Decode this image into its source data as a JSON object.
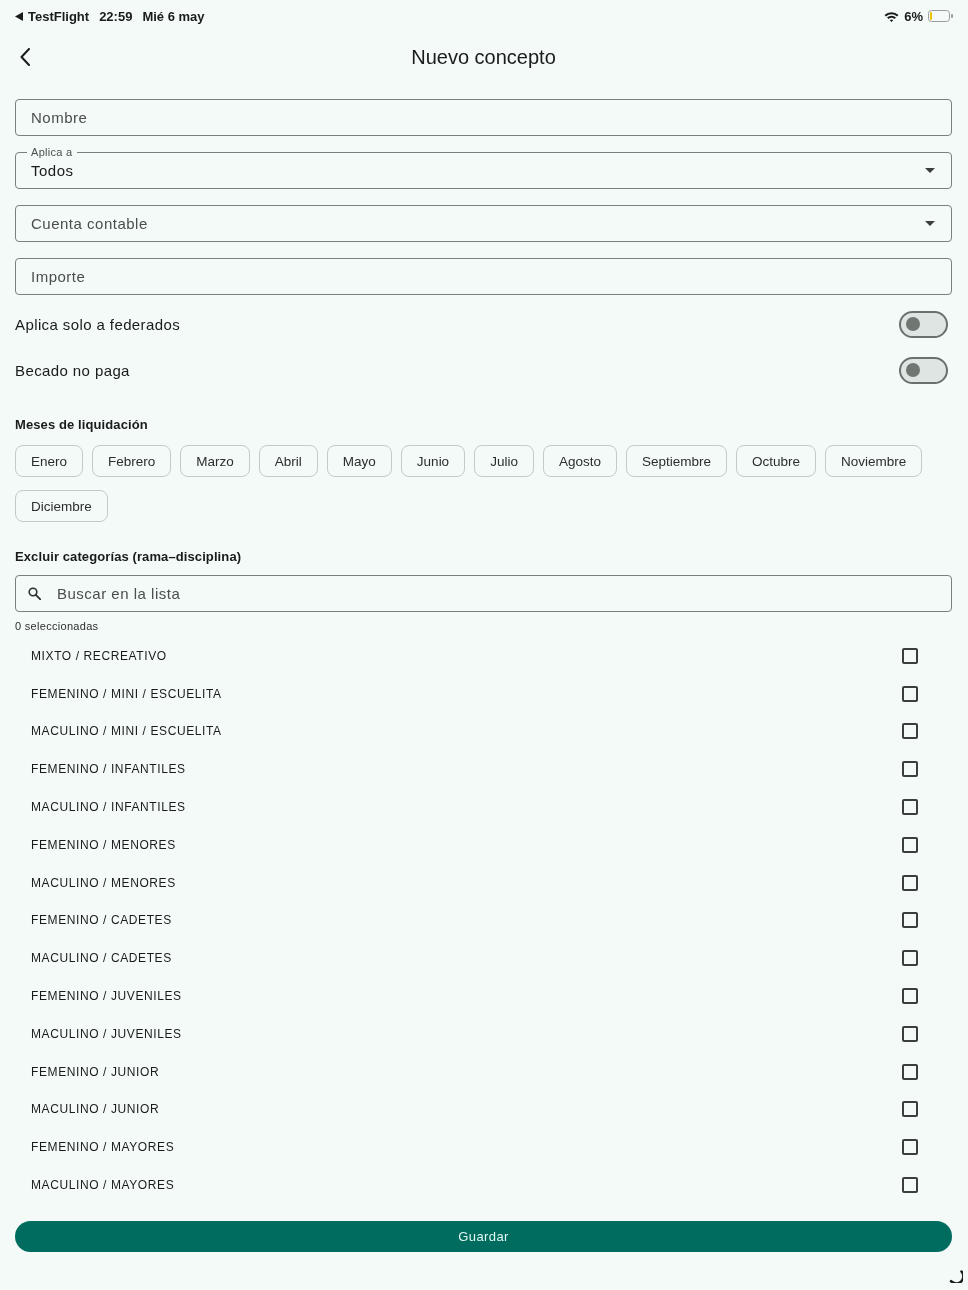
{
  "status_bar": {
    "back_app": "TestFlight",
    "time": "22:59",
    "date": "Mié 6 may",
    "battery_percent": "6%"
  },
  "header": {
    "title": "Nuevo concepto"
  },
  "fields": [
    {
      "kind": "text",
      "placeholder": "Nombre"
    },
    {
      "kind": "select",
      "label": "Aplica a",
      "value": "Todos"
    },
    {
      "kind": "select",
      "placeholder": "Cuenta contable"
    },
    {
      "kind": "text",
      "placeholder": "Importe"
    }
  ],
  "toggles": [
    {
      "label": "Aplica solo a federados",
      "on": false
    },
    {
      "label": "Becado no paga",
      "on": false
    }
  ],
  "months": {
    "title": "Meses de liquidación",
    "items": [
      {
        "label": "Enero",
        "selected": false
      },
      {
        "label": "Febrero",
        "selected": false
      },
      {
        "label": "Marzo",
        "selected": false
      },
      {
        "label": "Abril",
        "selected": false
      },
      {
        "label": "Mayo",
        "selected": false
      },
      {
        "label": "Junio",
        "selected": false
      },
      {
        "label": "Julio",
        "selected": false
      },
      {
        "label": "Agosto",
        "selected": false
      },
      {
        "label": "Septiembre",
        "selected": false
      },
      {
        "label": "Octubre",
        "selected": false
      },
      {
        "label": "Noviembre",
        "selected": false
      },
      {
        "label": "Diciembre",
        "selected": false
      }
    ]
  },
  "categories": {
    "title": "Excluir categorías (rama–disciplina)",
    "search": {
      "placeholder": "Buscar en la lista"
    },
    "count": "0 seleccionadas",
    "items": [
      {
        "label": "MIXTO / RECREATIVO",
        "checked": false
      },
      {
        "label": "FEMENINO / MINI / ESCUELITA",
        "checked": false
      },
      {
        "label": "MACULINO / MINI / ESCUELITA",
        "checked": false
      },
      {
        "label": "FEMENINO / INFANTILES",
        "checked": false
      },
      {
        "label": "MACULINO / INFANTILES",
        "checked": false
      },
      {
        "label": "FEMENINO / MENORES",
        "checked": false
      },
      {
        "label": "MACULINO / MENORES",
        "checked": false
      },
      {
        "label": "FEMENINO / CADETES",
        "checked": false
      },
      {
        "label": "MACULINO / CADETES",
        "checked": false
      },
      {
        "label": "FEMENINO / JUVENILES",
        "checked": false
      },
      {
        "label": "MACULINO / JUVENILES",
        "checked": false
      },
      {
        "label": "FEMENINO / JUNIOR",
        "checked": false
      },
      {
        "label": "MACULINO / JUNIOR",
        "checked": false
      },
      {
        "label": "FEMENINO / MAYORES",
        "checked": false
      },
      {
        "label": "MACULINO / MAYORES",
        "checked": false
      }
    ]
  },
  "save_button": "Guardar"
}
